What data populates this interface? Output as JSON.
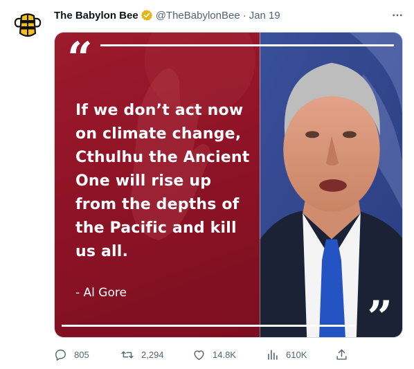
{
  "tweet": {
    "author_name": "The Babylon Bee",
    "handle": "@TheBabylonBee",
    "separator": "·",
    "date": "Jan 19"
  },
  "media": {
    "quote_lines": [
      "If we don’t act now",
      "on climate change,",
      "Cthulhu the Ancient",
      "One will rise up",
      "from the depths of",
      "the Pacific and kill",
      "us all."
    ],
    "attribution": "- Al Gore",
    "open_quote": "“",
    "close_quote": "”",
    "panel_color": "#8f1326"
  },
  "actions": {
    "replies": "805",
    "retweets": "2,294",
    "likes": "14.8K",
    "views": "610K"
  },
  "colors": {
    "verified_gold": "#e2b719",
    "secondary_text": "#536471",
    "primary_text": "#0f1419"
  },
  "icons": [
    "bee-logo-icon",
    "verified-badge-icon",
    "more-icon",
    "reply-icon",
    "retweet-icon",
    "like-icon",
    "views-icon",
    "share-icon"
  ]
}
